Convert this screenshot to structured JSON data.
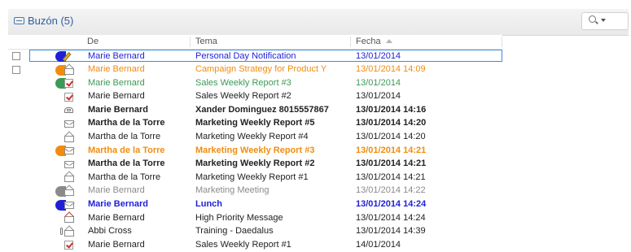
{
  "header": {
    "title": "Buzón (5)",
    "icon": "inbox-icon",
    "search_icon": "search-icon"
  },
  "columns": {
    "from": "De",
    "subject": "Tema",
    "date": "Fecha",
    "sort_indicator": "ascending"
  },
  "colors": {
    "blue": "#1f1fd8",
    "orange": "#f28c0f",
    "green": "#3b9a55",
    "gray": "#8a8a8a",
    "selection_border": "#3c8de0",
    "title_blue": "#2f5d99"
  },
  "messages": [
    {
      "from": "Marie Bernard",
      "subject": "Personal Day Notification",
      "date": "13/01/2014",
      "bold": false,
      "color": "blue",
      "category": "blue",
      "icon": "pencil-icon",
      "checkbox": true,
      "selected": true
    },
    {
      "from": "Marie Bernard",
      "subject": "Campaign Strategy for Product Y",
      "date": "13/01/2014 14:09",
      "bold": false,
      "color": "orange",
      "category": "orange",
      "icon": "envelope-open-icon",
      "checkbox": true,
      "selected": false
    },
    {
      "from": "Marie Bernard",
      "subject": "Sales Weekly Report #3",
      "date": "13/01/2014",
      "bold": false,
      "color": "green",
      "category": "green",
      "icon": "checkmark-icon",
      "checkbox": false,
      "selected": false
    },
    {
      "from": "Marie Bernard",
      "subject": "Sales Weekly Report #2",
      "date": "13/01/2014",
      "bold": false,
      "color": "black",
      "category": "",
      "icon": "checkmark-icon",
      "checkbox": false,
      "selected": false
    },
    {
      "from": "Marie Bernard",
      "subject": "Xander Dominguez 8015557867",
      "date": "13/01/2014 14:16",
      "bold": true,
      "color": "black",
      "category": "",
      "icon": "phone-icon",
      "checkbox": false,
      "selected": false
    },
    {
      "from": "Martha de la Torre",
      "subject": "Marketing Weekly Report #5",
      "date": "13/01/2014 14:20",
      "bold": true,
      "color": "black",
      "category": "",
      "icon": "envelope-icon",
      "checkbox": false,
      "selected": false
    },
    {
      "from": "Martha de la Torre",
      "subject": "Marketing Weekly Report #4",
      "date": "13/01/2014 14:20",
      "bold": false,
      "color": "black",
      "category": "",
      "icon": "envelope-open-icon",
      "checkbox": false,
      "selected": false
    },
    {
      "from": "Martha de la Torre",
      "subject": "Marketing Weekly Report #3",
      "date": "13/01/2014 14:21",
      "bold": true,
      "color": "orange",
      "category": "orange",
      "icon": "envelope-icon",
      "checkbox": false,
      "selected": false
    },
    {
      "from": "Martha de la Torre",
      "subject": "Marketing Weekly Report #2",
      "date": "13/01/2014 14:21",
      "bold": true,
      "color": "black",
      "category": "",
      "icon": "envelope-icon",
      "checkbox": false,
      "selected": false
    },
    {
      "from": "Martha de la Torre",
      "subject": "Marketing Weekly Report #1",
      "date": "13/01/2014 14:21",
      "bold": false,
      "color": "black",
      "category": "",
      "icon": "envelope-open-icon",
      "checkbox": false,
      "selected": false
    },
    {
      "from": "Marie Bernard",
      "subject": "Marketing Meeting",
      "date": "13/01/2014 14:22",
      "bold": false,
      "color": "gray",
      "category": "gray",
      "icon": "envelope-open-icon",
      "checkbox": false,
      "selected": false
    },
    {
      "from": "Marie Bernard",
      "subject": "Lunch",
      "date": "13/01/2014 14:24",
      "bold": true,
      "color": "blue",
      "category": "blue",
      "icon": "envelope-icon",
      "checkbox": false,
      "selected": false
    },
    {
      "from": "Marie Bernard",
      "subject": "High Priority Message",
      "date": "13/01/2014 14:24",
      "bold": false,
      "color": "black",
      "category": "",
      "icon": "envelope-open-red-icon",
      "checkbox": false,
      "selected": false
    },
    {
      "from": "Abbi Cross",
      "subject": "Training - Daedalus",
      "date": "13/01/2014 14:39",
      "bold": false,
      "color": "black",
      "category": "",
      "icon": "envelope-attachment-icon",
      "checkbox": false,
      "selected": false
    },
    {
      "from": "Marie Bernard",
      "subject": "Sales Weekly Report #1",
      "date": "14/01/2014",
      "bold": false,
      "color": "black",
      "category": "",
      "icon": "checkmark-icon",
      "checkbox": false,
      "selected": false
    }
  ]
}
